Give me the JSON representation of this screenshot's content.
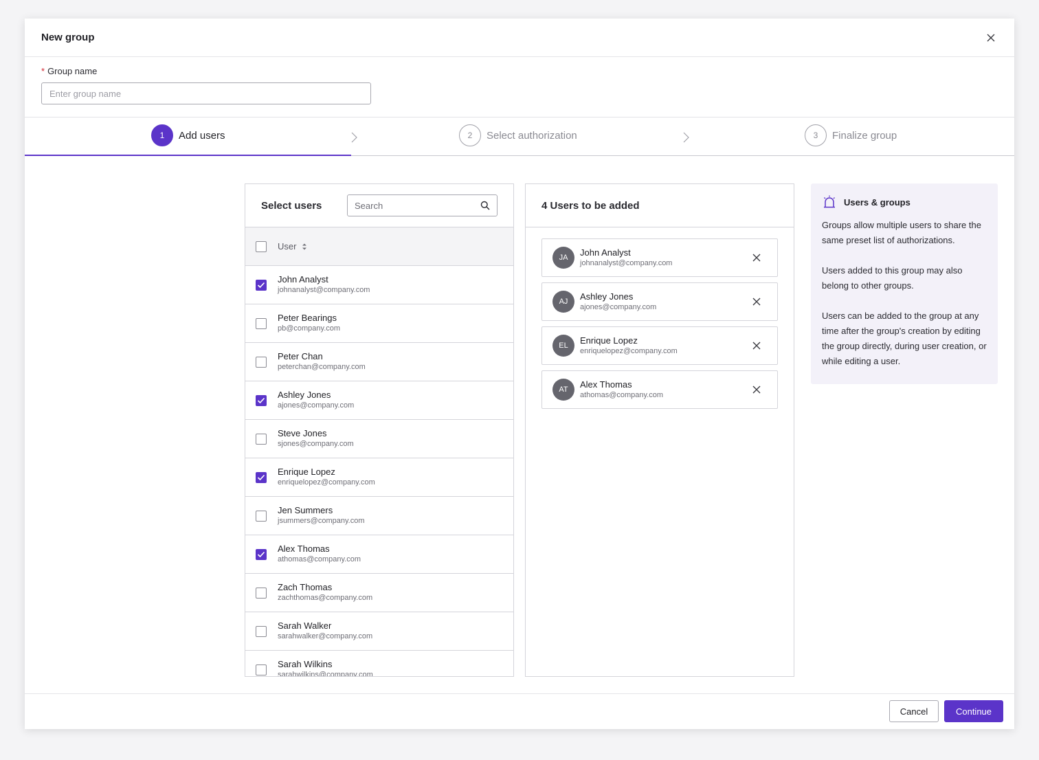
{
  "dialog": {
    "title": "New group"
  },
  "group_name": {
    "label": "Group name",
    "required_mark": "*",
    "placeholder": "Enter group name",
    "value": ""
  },
  "steps": [
    {
      "number": "1",
      "label": "Add users",
      "active": true
    },
    {
      "number": "2",
      "label": "Select authorization",
      "active": false
    },
    {
      "number": "3",
      "label": "Finalize group",
      "active": false
    }
  ],
  "select_users": {
    "title": "Select users",
    "search_placeholder": "Search",
    "column_header": "User",
    "users": [
      {
        "name": "John Analyst",
        "email": "johnanalyst@company.com",
        "checked": true
      },
      {
        "name": "Peter Bearings",
        "email": "pb@company.com",
        "checked": false
      },
      {
        "name": "Peter Chan",
        "email": "peterchan@company.com",
        "checked": false
      },
      {
        "name": "Ashley Jones",
        "email": "ajones@company.com",
        "checked": true
      },
      {
        "name": "Steve Jones",
        "email": "sjones@company.com",
        "checked": false
      },
      {
        "name": "Enrique Lopez",
        "email": "enriquelopez@company.com",
        "checked": true
      },
      {
        "name": "Jen Summers",
        "email": "jsummers@company.com",
        "checked": false
      },
      {
        "name": "Alex Thomas",
        "email": "athomas@company.com",
        "checked": true
      },
      {
        "name": "Zach Thomas",
        "email": "zachthomas@company.com",
        "checked": false
      },
      {
        "name": "Sarah Walker",
        "email": "sarahwalker@company.com",
        "checked": false
      },
      {
        "name": "Sarah Wilkins",
        "email": "sarahwilkins@company.com",
        "checked": false
      }
    ]
  },
  "to_be_added": {
    "title": "4 Users to be added",
    "users": [
      {
        "initials": "JA",
        "name": "John Analyst",
        "email": "johnanalyst@company.com"
      },
      {
        "initials": "AJ",
        "name": "Ashley Jones",
        "email": "ajones@company.com"
      },
      {
        "initials": "EL",
        "name": "Enrique Lopez",
        "email": "enriquelopez@company.com"
      },
      {
        "initials": "AT",
        "name": "Alex Thomas",
        "email": "athomas@company.com"
      }
    ]
  },
  "info": {
    "title": "Users & groups",
    "icon": "alarm-icon",
    "paragraphs": [
      "Groups allow multiple users to share the same preset list of authorizations.",
      "Users added to this group may also belong to other groups.",
      "Users can be added to the group at any time after the group's creation by editing the group directly, during user creation, or while editing a user."
    ]
  },
  "footer": {
    "cancel_label": "Cancel",
    "continue_label": "Continue"
  },
  "colors": {
    "accent": "#5b34c9",
    "avatar": "#65656d",
    "info_bg": "#f3f1f9"
  }
}
